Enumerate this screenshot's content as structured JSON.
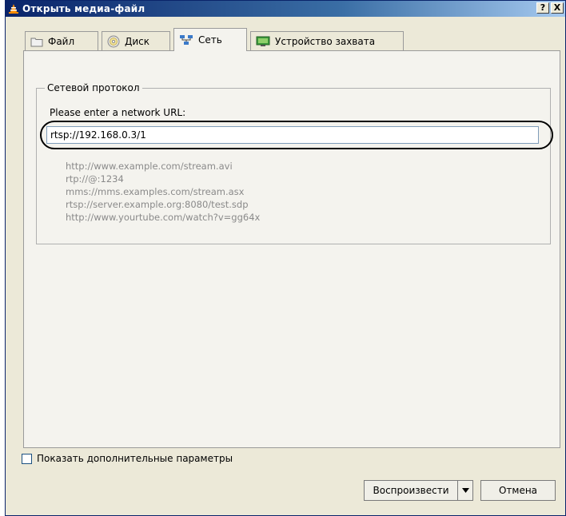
{
  "window": {
    "title": "Открыть медиа-файл",
    "help_button": "?",
    "close_button": "X",
    "icon": "vlc-cone-icon"
  },
  "tabs": [
    {
      "label": "Файл",
      "icon": "folder-icon",
      "active": false
    },
    {
      "label": "Диск",
      "icon": "disc-icon",
      "active": false
    },
    {
      "label": "Сеть",
      "icon": "network-icon",
      "active": true
    },
    {
      "label": "Устройство захвата",
      "icon": "capture-device-icon",
      "active": false
    }
  ],
  "network": {
    "group_title": "Сетевой протокол",
    "url_label": "Please enter a network URL:",
    "url_value": "rtsp://192.168.0.3/1",
    "examples": [
      "http://www.example.com/stream.avi",
      "rtp://@:1234",
      "mms://mms.examples.com/stream.asx",
      "rtsp://server.example.org:8080/test.sdp",
      "http://www.yourtube.com/watch?v=gg64x"
    ]
  },
  "footer": {
    "show_more_label": "Показать дополнительные параметры",
    "show_more_checked": false,
    "play_label": "Воспроизвести",
    "cancel_label": "Отмена"
  },
  "colors": {
    "titlebar_start": "#0a246a",
    "titlebar_end": "#a6caf0",
    "dialog_bg": "#ece9d8",
    "highlight": "#000000",
    "example_text": "#8a8a8a"
  }
}
